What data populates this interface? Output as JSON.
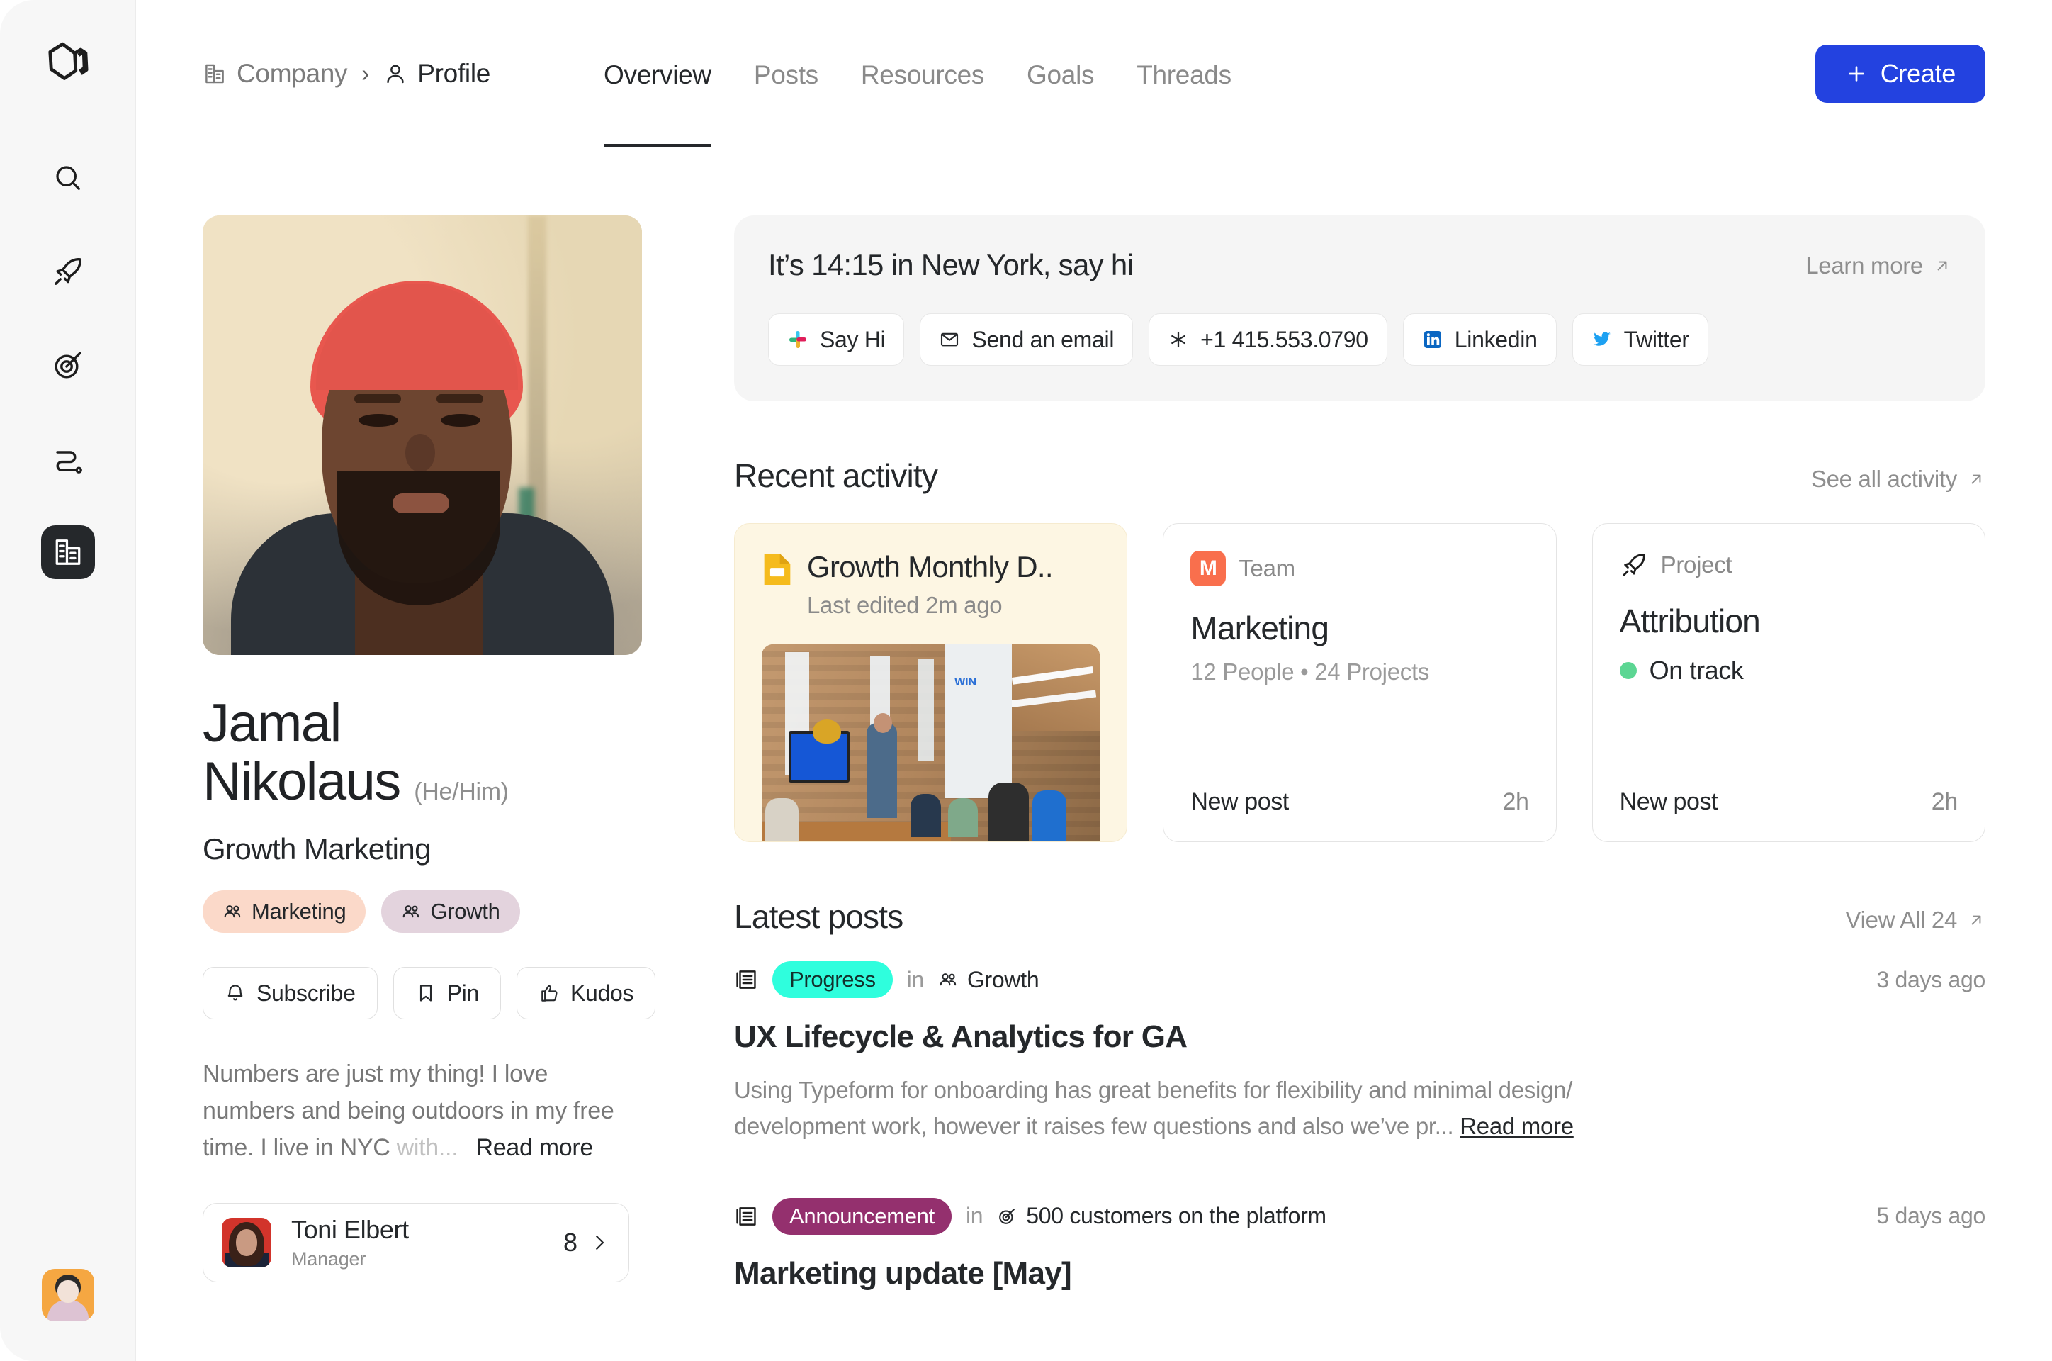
{
  "sidebar": {
    "logo": "hexagon-logo",
    "items": [
      {
        "name": "search",
        "icon": "search-icon",
        "active": false
      },
      {
        "name": "launches",
        "icon": "rocket-icon",
        "active": false
      },
      {
        "name": "goals",
        "icon": "target-icon",
        "active": false
      },
      {
        "name": "flows",
        "icon": "path-icon",
        "active": false
      },
      {
        "name": "company",
        "icon": "company-icon",
        "active": true
      }
    ],
    "avatar": "user-avatar"
  },
  "topbar": {
    "breadcrumb": [
      {
        "label": "Company",
        "icon": "company-icon"
      },
      {
        "label": "Profile",
        "icon": "person-icon"
      }
    ],
    "separator": "›",
    "tabs": [
      {
        "label": "Overview",
        "active": true
      },
      {
        "label": "Posts",
        "active": false
      },
      {
        "label": "Resources",
        "active": false
      },
      {
        "label": "Goals",
        "active": false
      },
      {
        "label": "Threads",
        "active": false
      }
    ],
    "create_label": "Create",
    "create_color": "#2342e0"
  },
  "profile": {
    "photo_alt": "profile-photo",
    "first_name": "Jamal",
    "last_name": "Nikolaus",
    "pronouns": "(He/Him)",
    "role": "Growth Marketing",
    "tags": [
      {
        "label": "Marketing",
        "icon": "people-icon",
        "color": "#fbd9c9"
      },
      {
        "label": "Growth",
        "icon": "people-icon",
        "color": "#e3d3dd"
      }
    ],
    "actions": [
      {
        "label": "Subscribe",
        "icon": "bell-icon"
      },
      {
        "label": "Pin",
        "icon": "bookmark-icon"
      },
      {
        "label": "Kudos",
        "icon": "thumbs-up-icon"
      }
    ],
    "bio_text": "Numbers are just my thing! I love numbers and being outdoors in my free time. I live in NYC",
    "bio_fade": "with...",
    "bio_more": "Read more",
    "manager": {
      "name": "Toni Elbert",
      "role": "Manager",
      "count": "8",
      "chevron": "chevron-right-icon"
    }
  },
  "contact": {
    "title": "It’s 14:15 in New York, say hi",
    "learn_more": "Learn more",
    "buttons": [
      {
        "label": "Say Hi",
        "icon": "slack-icon"
      },
      {
        "label": "Send an email",
        "icon": "mail-icon"
      },
      {
        "label": "+1 415.553.0790",
        "icon": "phone-icon"
      },
      {
        "label": "Linkedin",
        "icon": "linkedin-icon"
      },
      {
        "label": "Twitter",
        "icon": "twitter-icon"
      }
    ]
  },
  "recent_activity": {
    "title": "Recent activity",
    "link": "See all activity",
    "cards": [
      {
        "kind": "document",
        "icon": "google-slides-icon",
        "title": "Growth Monthly D..",
        "subtitle": "Last edited 2m ago",
        "thumb": "meeting-photo"
      },
      {
        "kind": "team",
        "kicker": "Team",
        "badge_letter": "M",
        "badge_color": "#f96f4d",
        "title": "Marketing",
        "meta": "12 People • 24 Projects",
        "footer_label": "New post",
        "footer_time": "2h"
      },
      {
        "kind": "project",
        "kicker": "Project",
        "icon": "rocket-icon",
        "title": "Attribution",
        "status": "On track",
        "status_color": "#5cd693",
        "footer_label": "New post",
        "footer_time": "2h"
      }
    ]
  },
  "latest_posts": {
    "title": "Latest posts",
    "link": "View All 24",
    "posts": [
      {
        "icon": "post-list-icon",
        "badge": "Progress",
        "badge_bg": "#2ffedd",
        "badge_fg": "#13312c",
        "in_word": "in",
        "context": "Growth",
        "context_icon": "people-icon",
        "date": "3 days ago",
        "title": "UX Lifecycle & Analytics for GA",
        "body": "Using Typeform for onboarding has great benefits for flexibility and minimal design/ development work, however it raises few questions and also we’ve pr...",
        "read_more": "Read more"
      },
      {
        "icon": "post-list-icon",
        "badge": "Announcement",
        "badge_bg": "#94306e",
        "badge_fg": "#ffffff",
        "in_word": "in",
        "context": "500 customers on the platform",
        "context_icon": "target-icon",
        "date": "5 days ago",
        "title": "Marketing update [May]",
        "body": "",
        "read_more": ""
      }
    ]
  }
}
